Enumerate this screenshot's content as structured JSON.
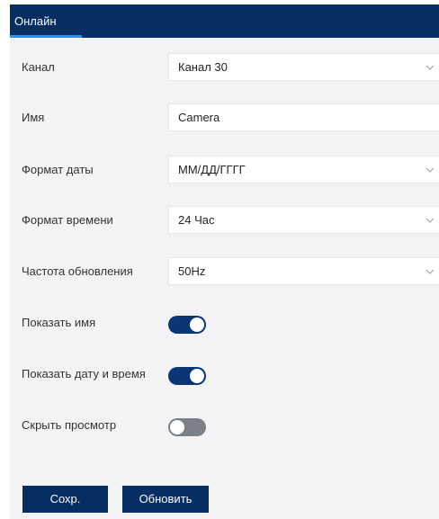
{
  "tabs": [
    {
      "label": "Онлайн",
      "active": true
    }
  ],
  "fields": {
    "channel": {
      "label": "Канал",
      "value": "Канал 30"
    },
    "name": {
      "label": "Имя",
      "value": "Camera"
    },
    "date_format": {
      "label": "Формат даты",
      "value": "ММ/ДД/ГГГГ"
    },
    "time_format": {
      "label": "Формат времени",
      "value": "24 Час"
    },
    "refresh_rate": {
      "label": "Частота обновления",
      "value": "50Hz"
    }
  },
  "toggles": {
    "show_name": {
      "label": "Показать имя",
      "on": true
    },
    "show_datetime": {
      "label": "Показать дату и время",
      "on": true
    },
    "hide_preview": {
      "label": "Скрыть просмотр",
      "on": false
    }
  },
  "buttons": {
    "save": "Сохр.",
    "refresh": "Обновить"
  },
  "colors": {
    "header": "#062e62",
    "accent": "#2c93e8",
    "toggle_on": "#0b3575",
    "toggle_off": "#7b8086",
    "panel": "#f3f3f5"
  }
}
